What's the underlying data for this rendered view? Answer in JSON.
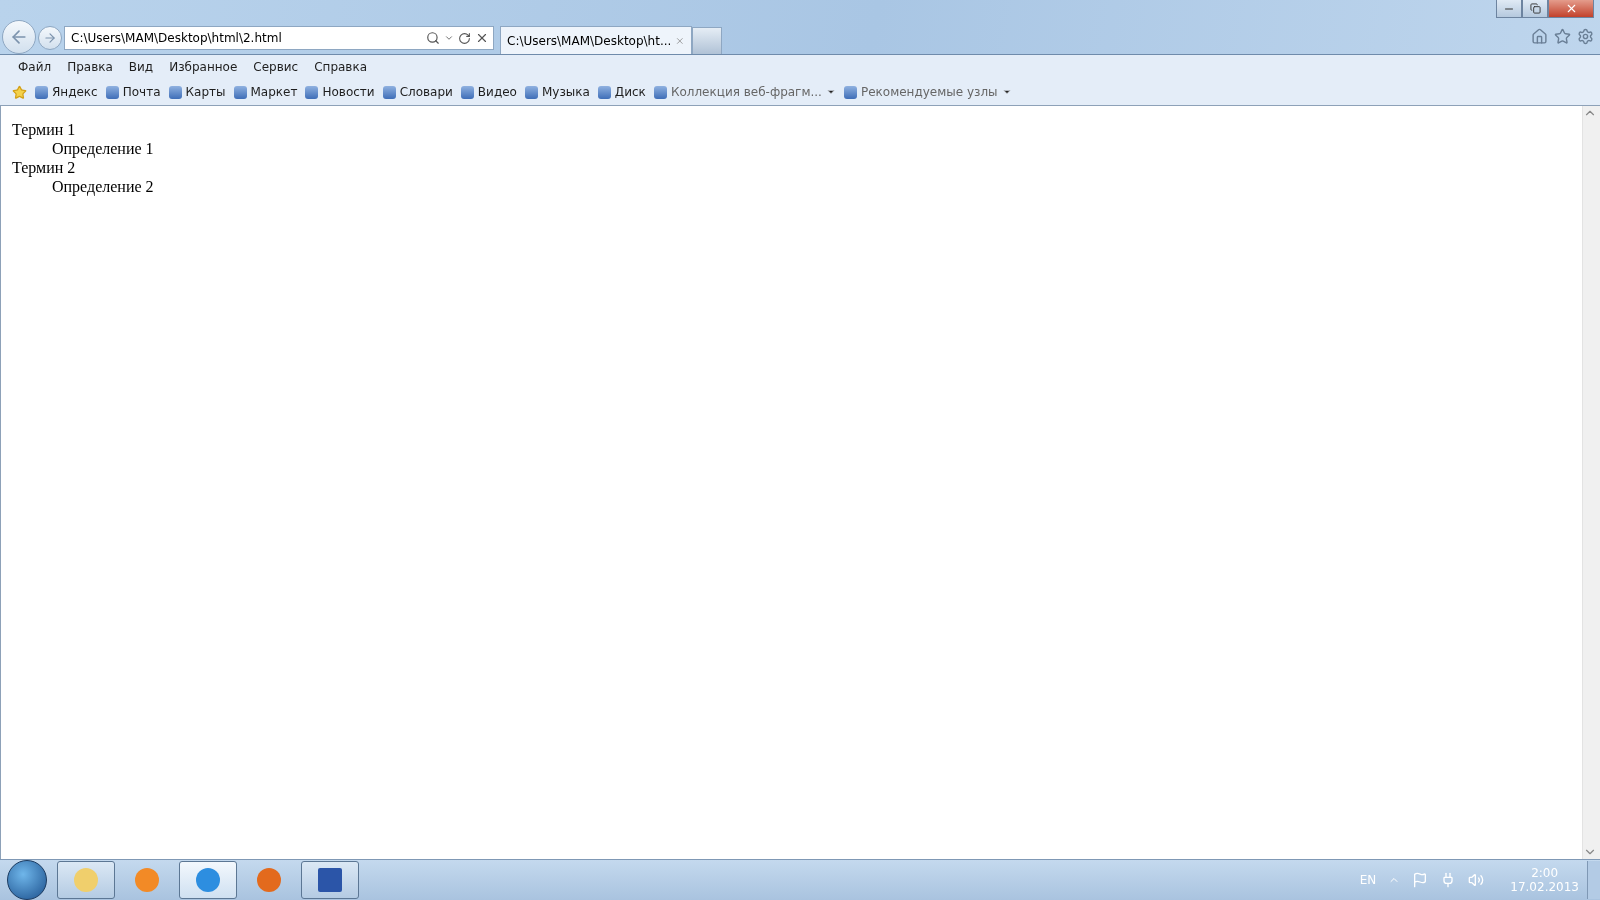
{
  "address_bar": {
    "value": "C:\\Users\\MAM\\Desktop\\html\\2.html"
  },
  "tabs": [
    {
      "label": "C:\\Users\\MAM\\Desktop\\ht...",
      "selected": true
    }
  ],
  "menu": [
    "Файл",
    "Правка",
    "Вид",
    "Избранное",
    "Сервис",
    "Справка"
  ],
  "favorites": [
    {
      "label": "Яндекс",
      "dropdown": false
    },
    {
      "label": "Почта",
      "dropdown": false
    },
    {
      "label": "Карты",
      "dropdown": false
    },
    {
      "label": "Маркет",
      "dropdown": false
    },
    {
      "label": "Новости",
      "dropdown": false
    },
    {
      "label": "Словари",
      "dropdown": false
    },
    {
      "label": "Видео",
      "dropdown": false
    },
    {
      "label": "Музыка",
      "dropdown": false
    },
    {
      "label": "Диск",
      "dropdown": false
    },
    {
      "label": "Коллекция веб-фрагм...",
      "dropdown": true
    },
    {
      "label": "Рекомендуемые узлы",
      "dropdown": true
    }
  ],
  "definition_list": [
    {
      "term": "Термин 1",
      "definition": "Определение 1"
    },
    {
      "term": "Термин 2",
      "definition": "Определение 2"
    }
  ],
  "taskbar": {
    "apps": [
      {
        "kind": "folder",
        "open": true,
        "selected": false
      },
      {
        "kind": "media",
        "open": false,
        "selected": false
      },
      {
        "kind": "browser",
        "open": true,
        "selected": true
      },
      {
        "kind": "firefox",
        "open": false,
        "selected": false
      },
      {
        "kind": "word",
        "open": true,
        "selected": false
      }
    ],
    "language": "EN",
    "time": "2:00",
    "date": "17.02.2013"
  }
}
